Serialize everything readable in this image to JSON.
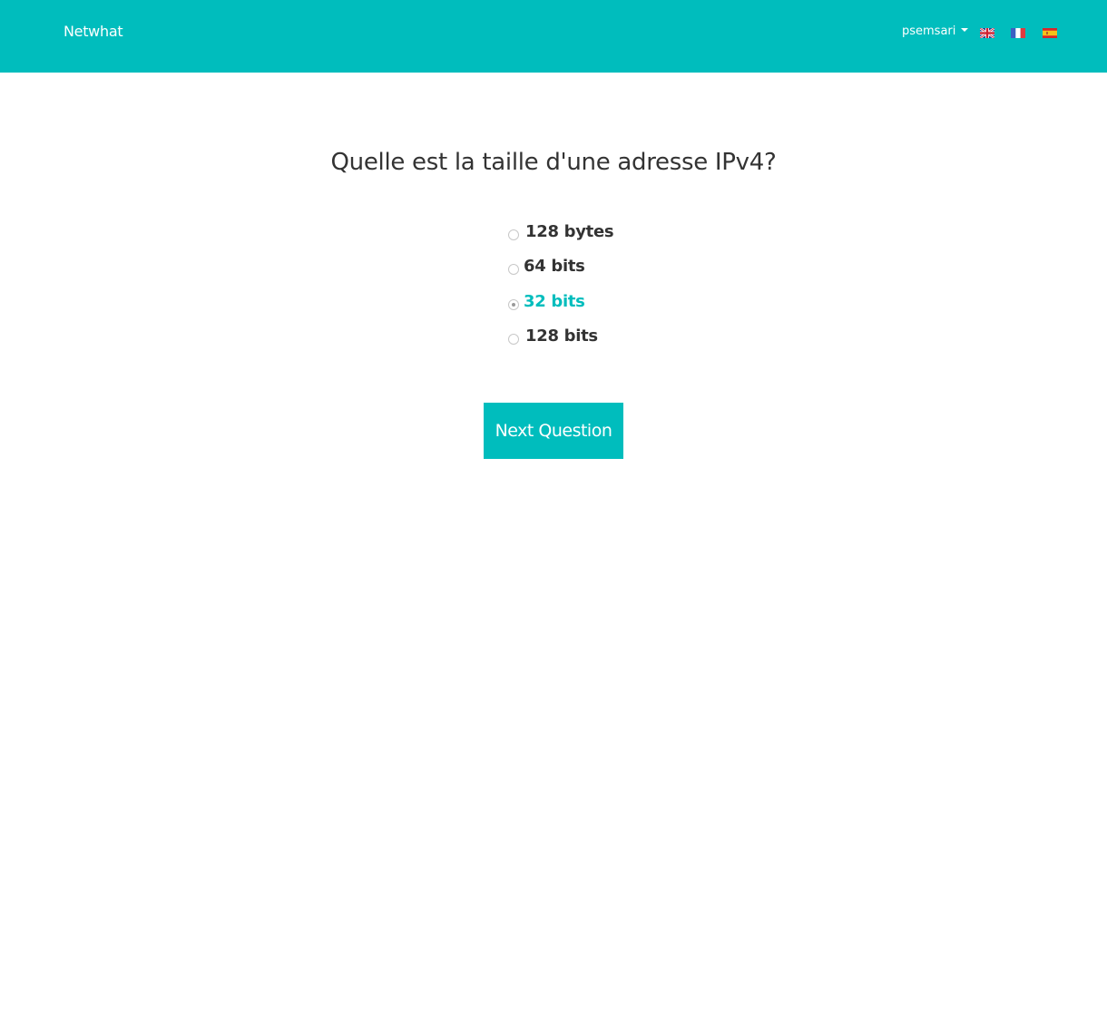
{
  "navbar": {
    "brand": "Netwhat",
    "user": "psemsari",
    "flags": [
      "flag-uk-icon",
      "flag-france-icon",
      "flag-spain-icon"
    ],
    "background_color": "#00BDBD"
  },
  "quiz": {
    "question": "Quelle est la taille d'une adresse IPv4?",
    "options": [
      {
        "label": "128 bytes",
        "selected": false
      },
      {
        "label": "64 bits",
        "selected": false
      },
      {
        "label": "32 bits",
        "selected": true
      },
      {
        "label": "128 bits",
        "selected": false
      }
    ],
    "next_button": "Next Question",
    "accent_color": "#00BDBD"
  }
}
